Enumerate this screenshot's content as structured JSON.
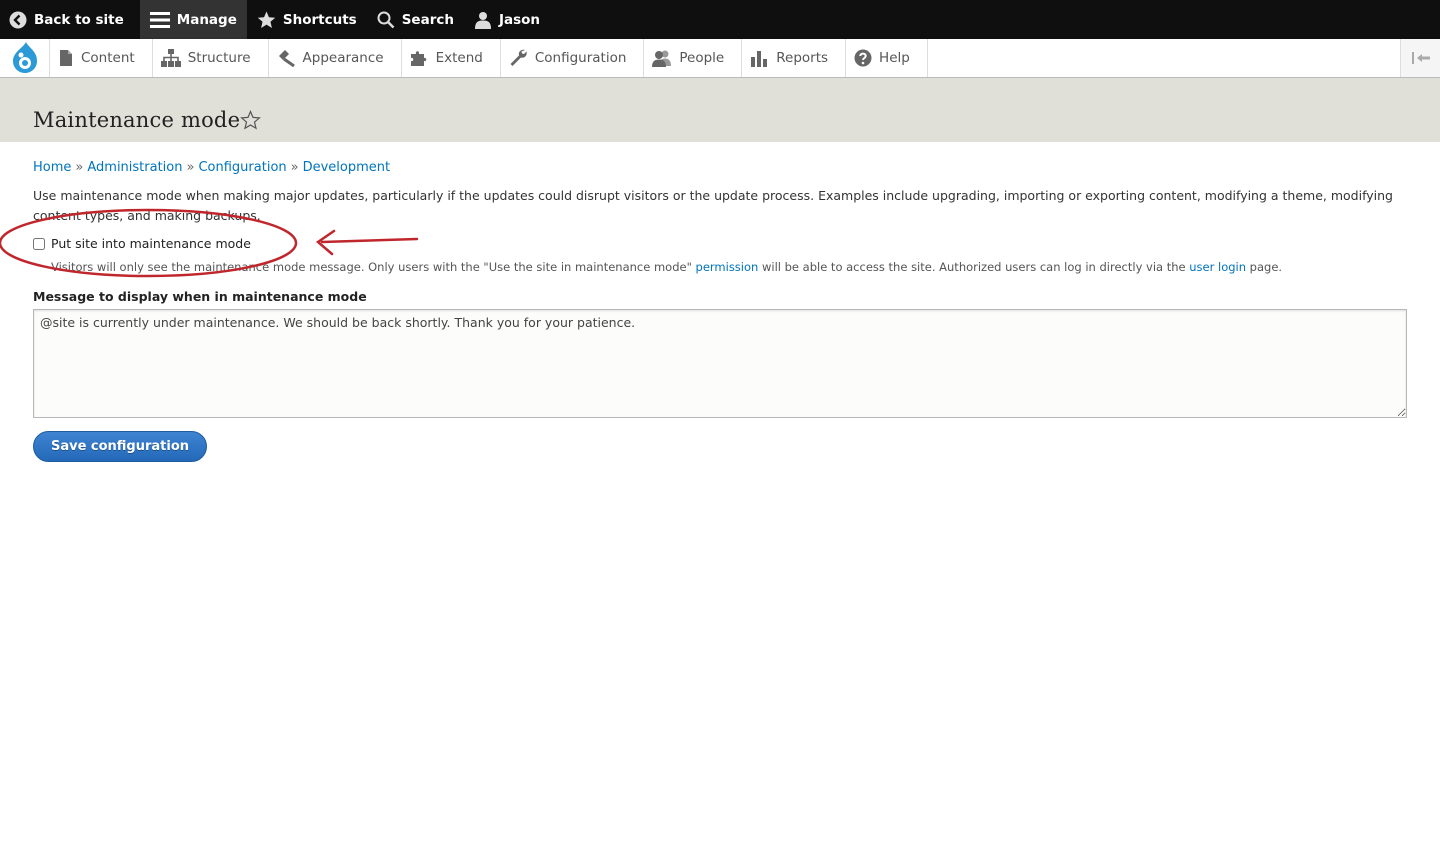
{
  "toolbar": {
    "back": "Back to site",
    "manage": "Manage",
    "shortcuts": "Shortcuts",
    "search": "Search",
    "user": "Jason"
  },
  "tray": {
    "items": [
      "Content",
      "Structure",
      "Appearance",
      "Extend",
      "Configuration",
      "People",
      "Reports",
      "Help"
    ]
  },
  "page": {
    "title": "Maintenance mode"
  },
  "breadcrumb": [
    "Home",
    "Administration",
    "Configuration",
    "Development"
  ],
  "breadcrumb_sep": "»",
  "description": "Use maintenance mode when making major updates, particularly if the updates could disrupt visitors or the update process. Examples include upgrading, importing or exporting content, modifying a theme, modifying content types, and making backups.",
  "maintenance_checkbox": {
    "label": "Put site into maintenance mode",
    "checked": false,
    "help_pre": "Visitors will only see the maintenance mode message. Only users with the \"Use the site in maintenance mode\" ",
    "help_link1": "permission",
    "help_mid": " will be able to access the site. Authorized users can log in directly via the ",
    "help_link2": "user login",
    "help_post": " page."
  },
  "message": {
    "label": "Message to display when in maintenance mode",
    "value": "@site is currently under maintenance. We should be back shortly. Thank you for your patience."
  },
  "save_label": "Save configuration",
  "colors": {
    "link": "#0074bd",
    "annotation": "#c0272d",
    "button": "#2f76c6"
  }
}
